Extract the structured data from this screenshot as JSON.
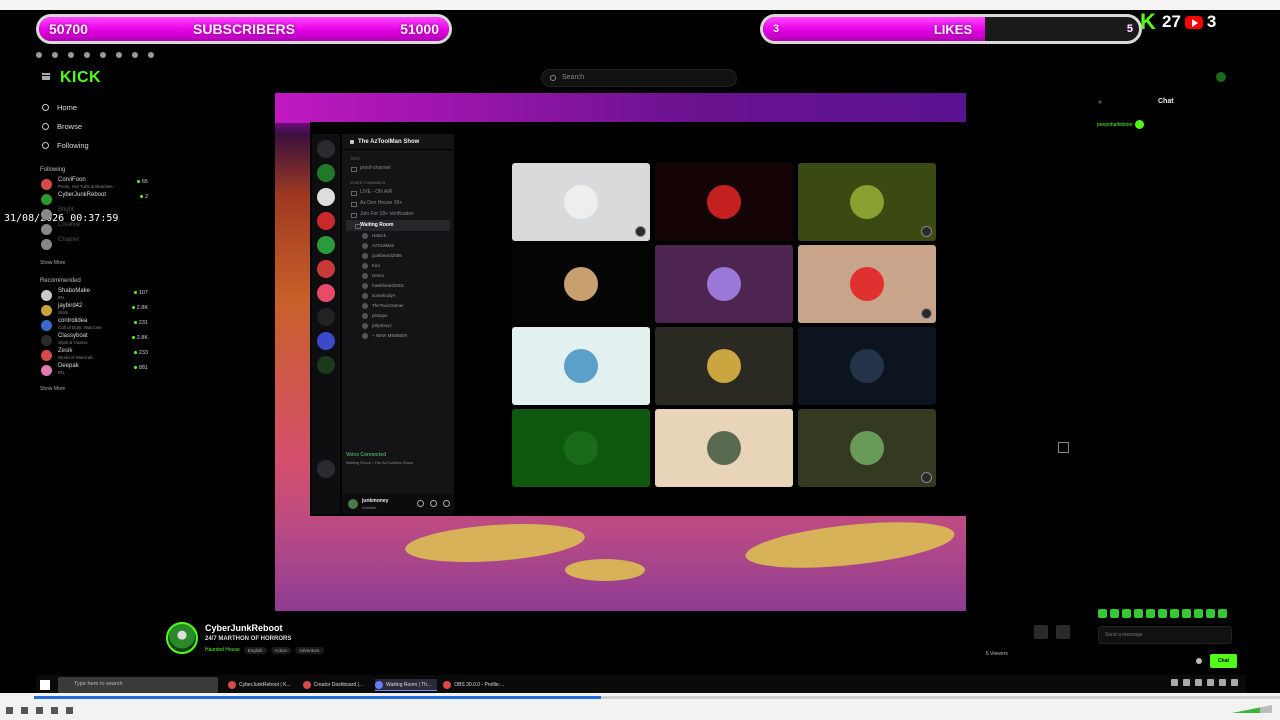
{
  "overlay": {
    "subscribers": {
      "current": "50700",
      "label": "SUBSCRIBERS",
      "goal": "51000",
      "progress": 1.0
    },
    "likes": {
      "current": "3",
      "label": "LIKES",
      "goal": "5",
      "progress": 0.59
    },
    "kick_count": "27",
    "youtube_count": "3"
  },
  "timestamp": "31/08/2026 00:37:59",
  "header": {
    "logo": "KICK",
    "search_placeholder": "Search"
  },
  "sidebar": {
    "nav": [
      "Home",
      "Browse",
      "Following"
    ],
    "following_heading": "Following",
    "following": [
      {
        "name": "CorviFoon",
        "sub": "Pools, Hot Tubs & Beaches",
        "viewers": "65",
        "color": "#d84a4a",
        "online": true
      },
      {
        "name": "CyberJunkReboot",
        "sub": "",
        "viewers": "2",
        "color": "#2a9a2a",
        "online": true
      },
      {
        "name": "Bright",
        "sub": "",
        "viewers": "",
        "color": "#888",
        "online": false
      },
      {
        "name": "Creative",
        "sub": "",
        "viewers": "",
        "color": "#888",
        "online": false
      },
      {
        "name": "Chapter",
        "sub": "",
        "viewers": "",
        "color": "#888",
        "online": false
      }
    ],
    "show_more": "Show More",
    "recommended_heading": "Recommended",
    "recommended": [
      {
        "name": "ShaboMake",
        "sub": "IRL",
        "viewers": "107",
        "color": "#c9c9c9"
      },
      {
        "name": "jaybird42",
        "sub": "Slots",
        "viewers": "2.8K",
        "color": "#c9a43a"
      },
      {
        "name": "controlidea",
        "sub": "Call of Duty: Warzone",
        "viewers": "231",
        "color": "#3a6ac9"
      },
      {
        "name": "Classyboat",
        "sub": "Slots & Casino",
        "viewers": "2.8K",
        "color": "#2a2a2a"
      },
      {
        "name": "Zesik",
        "sub": "World of Warcraft",
        "viewers": "233",
        "color": "#d84a4a"
      },
      {
        "name": "Deepak",
        "sub": "IRL",
        "viewers": "881",
        "color": "#e07ab0"
      }
    ],
    "show_more_2": "Show More"
  },
  "discord": {
    "guild": "The AzToolMan Show",
    "text_heading": "TEXT",
    "text_channels": [
      "proof-channel"
    ],
    "voice_heading": "VOICE CHANNELS",
    "voice_channels": [
      "LIVE - ON AIR",
      "Az Den House 18+",
      "Join For 18+ Verification"
    ],
    "active_channel": "Waiting Room",
    "members": [
      "Hatrick",
      "AzToolMan",
      "junkbeard2006",
      "Kiro",
      "Demo",
      "hawkbeard2001",
      "somebodyA",
      "TheToxicGamer",
      "plsaspe",
      "jollynboyz",
      "+ NEW MEMBER"
    ],
    "voice_status": "Voice Connected",
    "voice_sub": "Waiting Room / The AzToolMan Show",
    "user": {
      "name": "junkmoney",
      "status": "Invisible"
    },
    "tiles": [
      {
        "bg": "#d8dadc",
        "av": "#eeeeee",
        "badge": true
      },
      {
        "bg": "#140405",
        "av": "#c42020",
        "badge": false
      },
      {
        "bg": "#3a4a12",
        "av": "#8aa030",
        "badge": true
      },
      {
        "bg": "#050505",
        "av": "#c8a070",
        "badge": false
      },
      {
        "bg": "#4e2450",
        "av": "#9a78d8",
        "badge": false
      },
      {
        "bg": "#c8a48a",
        "av": "#e03030",
        "badge": true
      },
      {
        "bg": "#e2f0f0",
        "av": "#5aa0c8",
        "badge": false
      },
      {
        "bg": "#2a2a22",
        "av": "#caa640",
        "badge": false
      },
      {
        "bg": "#0c1420",
        "av": "#243448",
        "badge": false
      },
      {
        "bg": "#0e5810",
        "av": "#1a6a1a",
        "badge": false
      },
      {
        "bg": "#e8d4b8",
        "av": "#5a6a50",
        "badge": false
      },
      {
        "bg": "#343a20",
        "av": "#6a9a5a",
        "badge": true
      }
    ]
  },
  "chat": {
    "heading": "Chat",
    "collapse": "»",
    "message": "peepohallobtoor",
    "input_placeholder": "Send a message",
    "send_label": "Chat"
  },
  "stream": {
    "channel": "CyberJunkReboot",
    "title": "24/7 MARTHON OF HORRORS",
    "category": "Haunted House",
    "tags": [
      "English",
      "Action",
      "Adventure"
    ],
    "viewers": "6 Viewers"
  },
  "taskbar": {
    "search_placeholder": "Type here to search",
    "apps": [
      {
        "label": "CyberJunkReboot | K...",
        "color": "#d84a4a",
        "active": false
      },
      {
        "label": "Creator Dashboard |...",
        "color": "#d84a4a",
        "active": false
      },
      {
        "label": "Waiting Room | Th...",
        "color": "#6a7cff",
        "active": true
      },
      {
        "label": "OBS 30.0.0 - Profile:...",
        "color": "#d84a4a",
        "active": false
      }
    ]
  },
  "player": {
    "progress": 0.455
  }
}
